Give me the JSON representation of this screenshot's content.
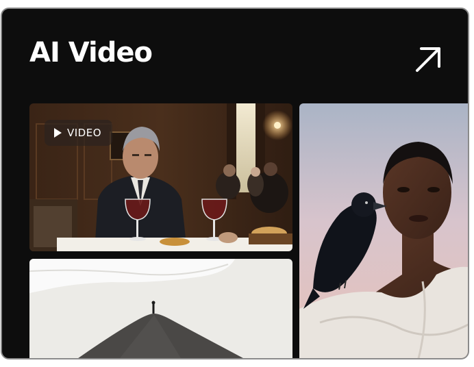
{
  "card": {
    "title": "AI Video",
    "open_icon": "arrow-up-right-icon"
  },
  "tiles": [
    {
      "kind": "video",
      "badge_label": "VIDEO",
      "badge_icon": "play-icon"
    },
    {
      "kind": "image"
    },
    {
      "kind": "image"
    }
  ]
}
